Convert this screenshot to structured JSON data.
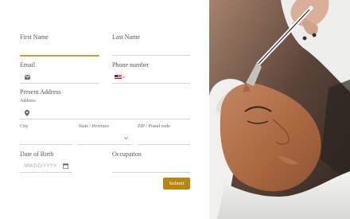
{
  "progress": {
    "fraction": 0.5
  },
  "form": {
    "first_name": {
      "label": "First Name",
      "value": ""
    },
    "last_name": {
      "label": "Last Name",
      "value": ""
    },
    "email": {
      "label": "Email",
      "value": ""
    },
    "phone": {
      "label": "Phone number",
      "value": "",
      "country_flag": "us-flag-icon"
    },
    "present_address": {
      "label": "Present Address"
    },
    "address": {
      "label": "Address",
      "value": ""
    },
    "city": {
      "label": "City",
      "value": ""
    },
    "state": {
      "label": "State / Province",
      "value": ""
    },
    "zip": {
      "label": "ZIP / Postal code",
      "value": ""
    },
    "dob": {
      "label": "Date of Birth",
      "placeholder": "MM/DD/YYYY"
    },
    "occupation": {
      "label": "Occupation",
      "value": ""
    },
    "submit_label": "Submit"
  },
  "colors": {
    "accent": "#b8860b",
    "active_underline": "#c9a227",
    "field_line": "#d6d6d6"
  },
  "icons": [
    "envelope-icon",
    "us-flag-icon",
    "location-pin-icon",
    "chevron-down-icon",
    "calendar-icon"
  ]
}
